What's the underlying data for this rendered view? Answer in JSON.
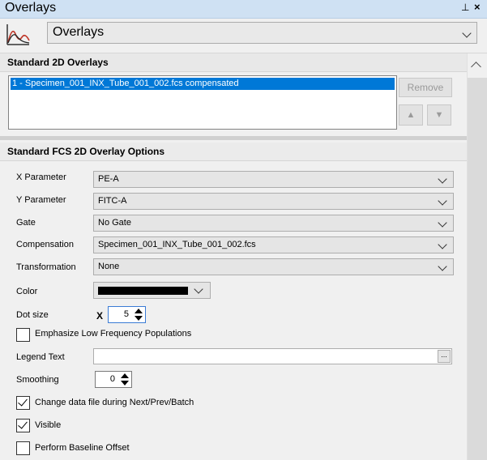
{
  "window": {
    "title": "Overlays",
    "pin_glyph": "⊥",
    "close_glyph": "×"
  },
  "header": {
    "selected_overlay": "Overlays"
  },
  "standard_overlays": {
    "title": "Standard 2D Overlays",
    "items": [
      "1 - Specimen_001_INX_Tube_001_002.fcs compensated"
    ],
    "remove_label": "Remove",
    "move_up_glyph": "▲",
    "move_down_glyph": "▼"
  },
  "options": {
    "title": "Standard FCS 2D Overlay Options",
    "x_parameter": {
      "label": "X Parameter",
      "value": "PE-A"
    },
    "y_parameter": {
      "label": "Y Parameter",
      "value": "FITC-A"
    },
    "gate": {
      "label": "Gate",
      "value": "No Gate"
    },
    "compensation": {
      "label": "Compensation",
      "value": "Specimen_001_INX_Tube_001_002.fcs"
    },
    "transformation": {
      "label": "Transformation",
      "value": "None"
    },
    "color": {
      "label": "Color",
      "value": "#000000"
    },
    "dot_size": {
      "label": "Dot size",
      "prefix": "X",
      "value": "5"
    },
    "emphasize": {
      "label": "Emphasize Low Frequency Populations",
      "checked": false
    },
    "legend_text": {
      "label": "Legend Text",
      "value": "",
      "browse_label": "..."
    },
    "smoothing": {
      "label": "Smoothing",
      "value": "0"
    },
    "change_data_file": {
      "label": "Change data file during Next/Prev/Batch",
      "checked": true
    },
    "visible": {
      "label": "Visible",
      "checked": true
    },
    "baseline_offset": {
      "label": "Perform Baseline Offset",
      "checked": false
    }
  },
  "colors": {
    "selection": "#0078d7",
    "titlebar": "#cfe1f3",
    "panel": "#f0f0f0"
  }
}
